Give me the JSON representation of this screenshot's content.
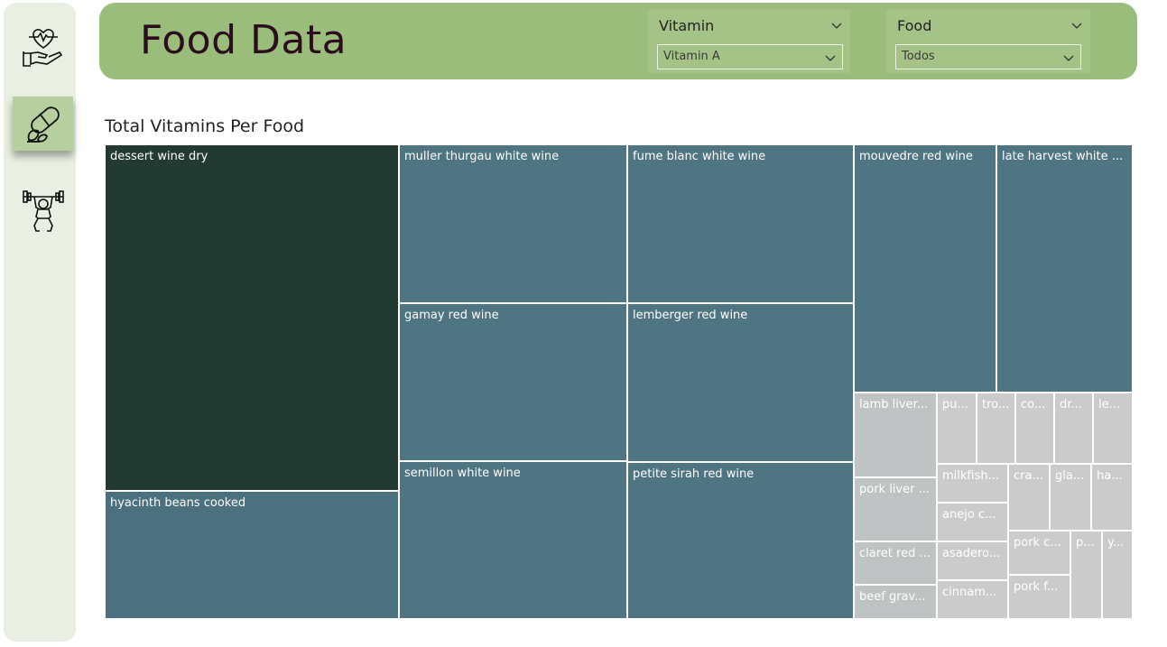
{
  "header": {
    "title": "Food Data"
  },
  "slicers": [
    {
      "label": "Vitamin",
      "value": "Vitamin A"
    },
    {
      "label": "Food",
      "value": "Todos"
    }
  ],
  "nav": [
    {
      "icon": "heart-hand-icon"
    },
    {
      "icon": "capsule-leaf-icon"
    },
    {
      "icon": "weightlifter-icon"
    }
  ],
  "visual": {
    "title": "Total Vitamins Per Food"
  },
  "colors": {
    "dark": "#233a33",
    "mid": "#4f7482",
    "mid2": "#4b717f",
    "light": "#c0c3c3",
    "lighter": "#cbcbcb",
    "header": "#9bbd7b",
    "sidebar": "#e9efe2"
  },
  "chart_data": {
    "type": "treemap",
    "title": "Total Vitamins Per Food",
    "items": [
      {
        "label": "dessert wine dry"
      },
      {
        "label": "hyacinth beans cooked"
      },
      {
        "label": "muller thurgau white wine"
      },
      {
        "label": "gamay red wine"
      },
      {
        "label": "semillon white wine"
      },
      {
        "label": "fume blanc white wine"
      },
      {
        "label": "lemberger red wine"
      },
      {
        "label": "petite sirah red wine"
      },
      {
        "label": "mouvedre red wine"
      },
      {
        "label": "late harvest white ..."
      },
      {
        "label": "lamb liver..."
      },
      {
        "label": "pork liver ..."
      },
      {
        "label": "claret red ..."
      },
      {
        "label": "beef grav..."
      },
      {
        "label": "pu..."
      },
      {
        "label": "tro..."
      },
      {
        "label": "co..."
      },
      {
        "label": "dr..."
      },
      {
        "label": "le..."
      },
      {
        "label": "milkfish..."
      },
      {
        "label": "anejo c..."
      },
      {
        "label": "asadero..."
      },
      {
        "label": "cinnam..."
      },
      {
        "label": "cra..."
      },
      {
        "label": "gla..."
      },
      {
        "label": "ha..."
      },
      {
        "label": "pork c..."
      },
      {
        "label": "pork f..."
      },
      {
        "label": "p..."
      },
      {
        "label": "y..."
      }
    ]
  }
}
